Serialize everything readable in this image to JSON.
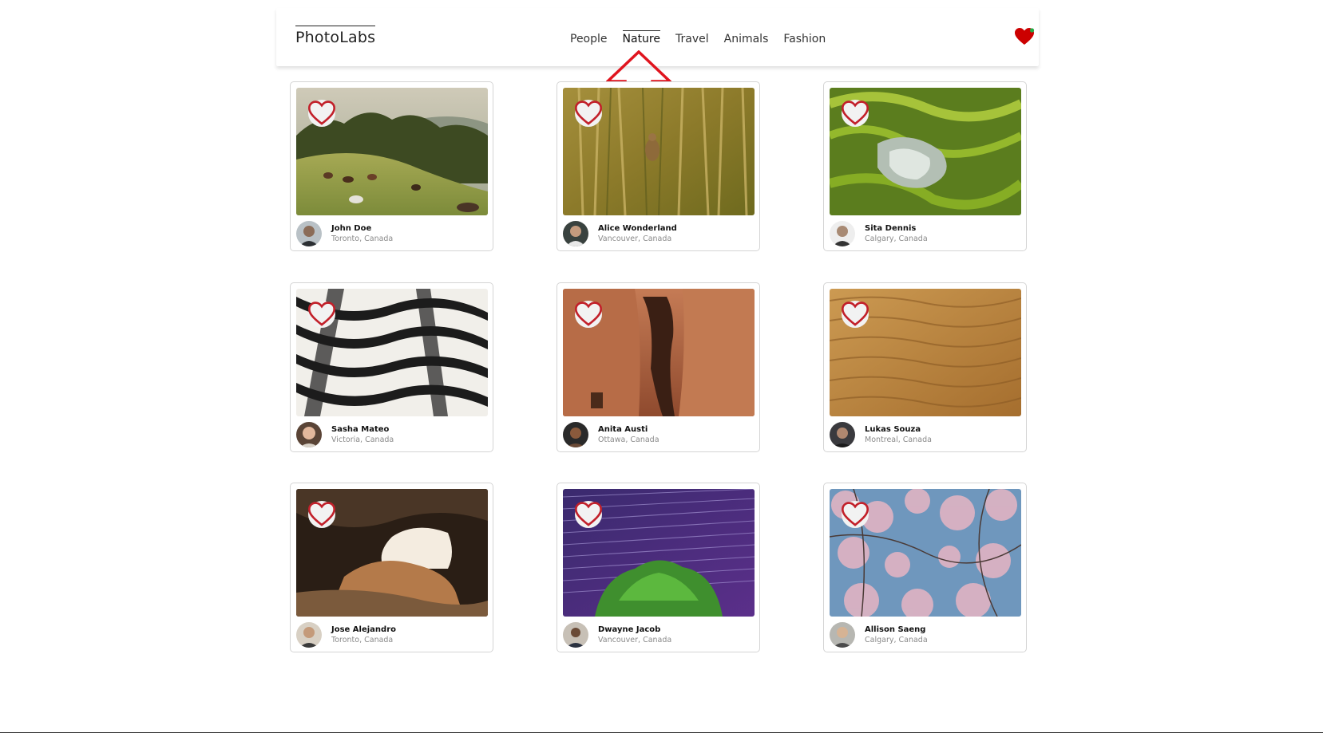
{
  "app": {
    "title": "PhotoLabs"
  },
  "nav": {
    "topics": [
      "People",
      "Nature",
      "Travel",
      "Animals",
      "Fashion"
    ],
    "active_topic": "Nature"
  },
  "favorites": {
    "icon": "heart-icon",
    "has_notification": true,
    "color": "#cc0000",
    "dot_color": "#22aa44"
  },
  "annotation": {
    "type": "arrow-up",
    "color": "#e0141e",
    "points_to": "Nature"
  },
  "photos": [
    {
      "user": "John Doe",
      "location": "Toronto, Canada",
      "subject": "horses on hillside"
    },
    {
      "user": "Alice Wonderland",
      "location": "Vancouver, Canada",
      "subject": "bird in reeds"
    },
    {
      "user": "Sita Dennis",
      "location": "Calgary, Canada",
      "subject": "rice terraces"
    },
    {
      "user": "Sasha Mateo",
      "location": "Victoria, Canada",
      "subject": "zebra stripes"
    },
    {
      "user": "Anita Austi",
      "location": "Ottawa, Canada",
      "subject": "canyon rocks"
    },
    {
      "user": "Lukas Souza",
      "location": "Montreal, Canada",
      "subject": "sand dunes"
    },
    {
      "user": "Jose Alejandro",
      "location": "Toronto, Canada",
      "subject": "cave"
    },
    {
      "user": "Dwayne Jacob",
      "location": "Vancouver, Canada",
      "subject": "star trails over tree"
    },
    {
      "user": "Allison Saeng",
      "location": "Calgary, Canada",
      "subject": "cherry blossoms"
    }
  ]
}
